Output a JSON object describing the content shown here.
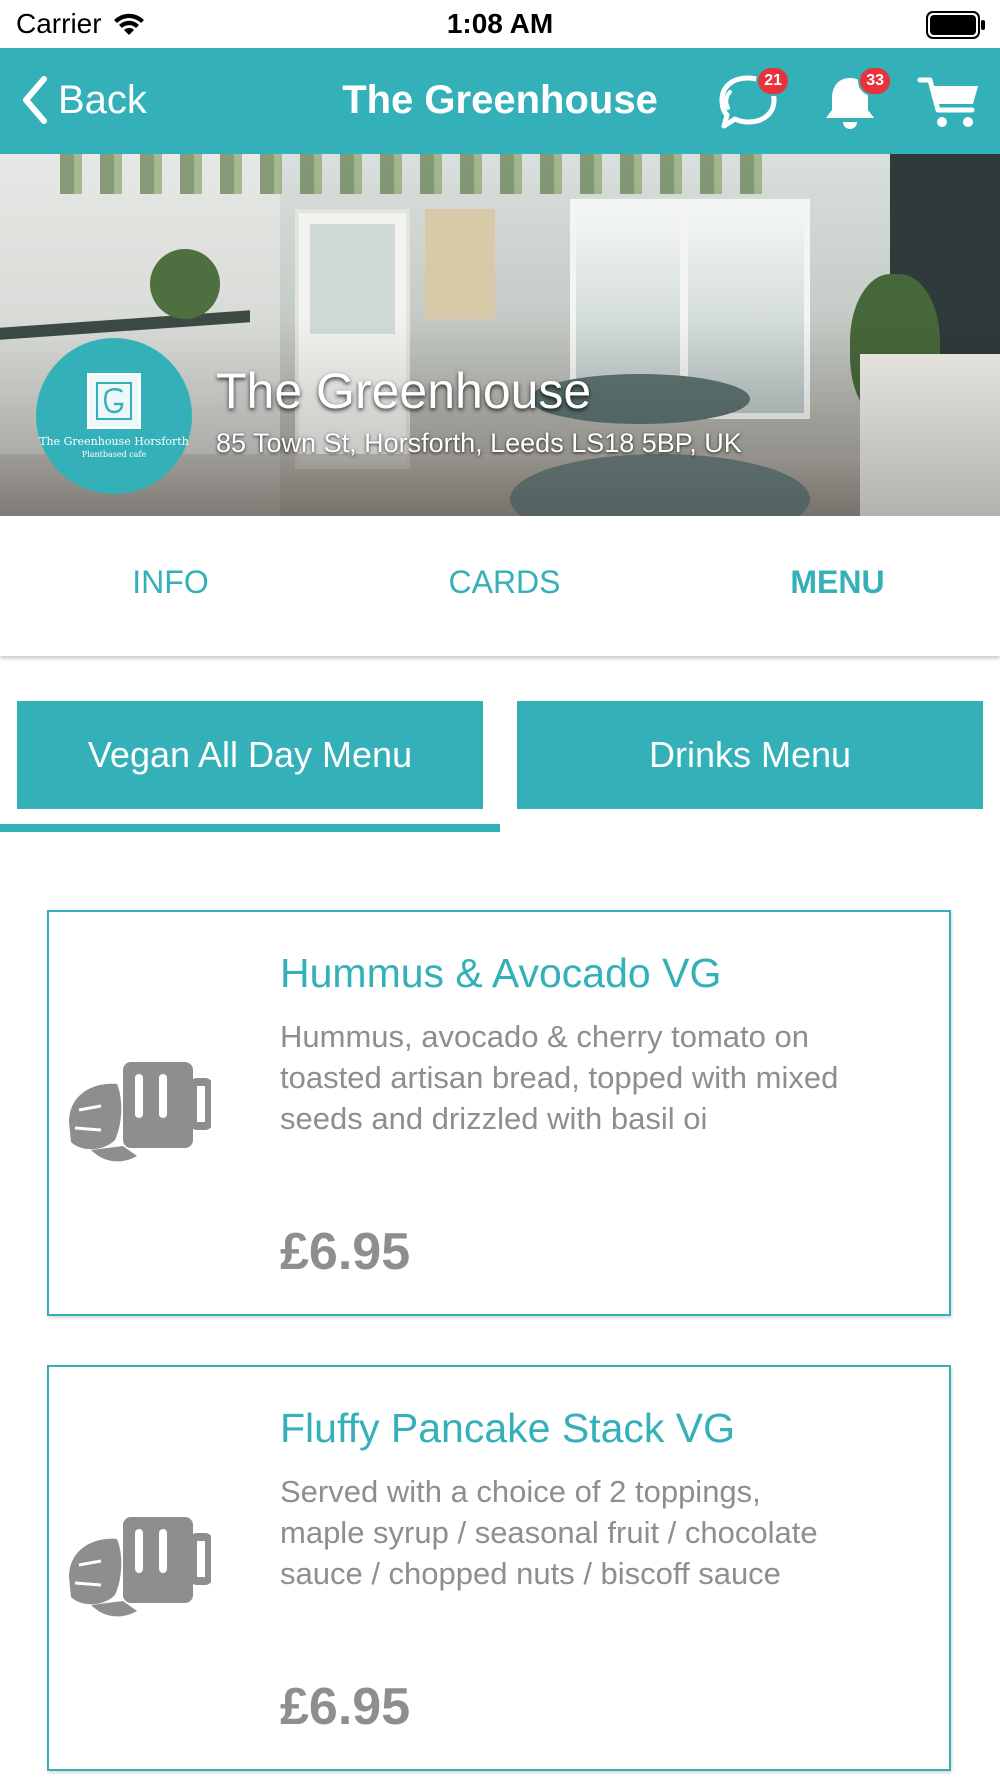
{
  "status_bar": {
    "carrier": "Carrier",
    "time": "1:08 AM"
  },
  "nav": {
    "back_label": "Back",
    "title": "The Greenhouse",
    "chat_badge": "21",
    "notifications_badge": "33"
  },
  "venue": {
    "name": "The Greenhouse",
    "address": "85 Town St, Horsforth, Leeds LS18 5BP, UK",
    "logo_name": "The Greenhouse Horsforth",
    "logo_tagline": "Plantbased cafe"
  },
  "tabs": [
    {
      "label": "INFO"
    },
    {
      "label": "CARDS"
    },
    {
      "label": "MENU"
    }
  ],
  "active_tab": "MENU",
  "menu_tabs": [
    {
      "label": "Vegan All Day Menu"
    },
    {
      "label": "Drinks Menu"
    }
  ],
  "menu_items": [
    {
      "title": "Hummus & Avocado VG",
      "description": "Hummus, avocado & cherry tomato on toasted artisan bread, topped with mixed seeds and drizzled with basil oi",
      "price": "£6.95"
    },
    {
      "title": "Fluffy Pancake Stack VG",
      "description": "Served with a choice of 2 toppings, maple syrup / seasonal fruit / chocolate sauce / chopped nuts / biscoff sauce",
      "price": "£6.95"
    }
  ],
  "colors": {
    "accent": "#33b0b8",
    "badge": "#e8333a",
    "muted_text": "#8e8e8e"
  }
}
